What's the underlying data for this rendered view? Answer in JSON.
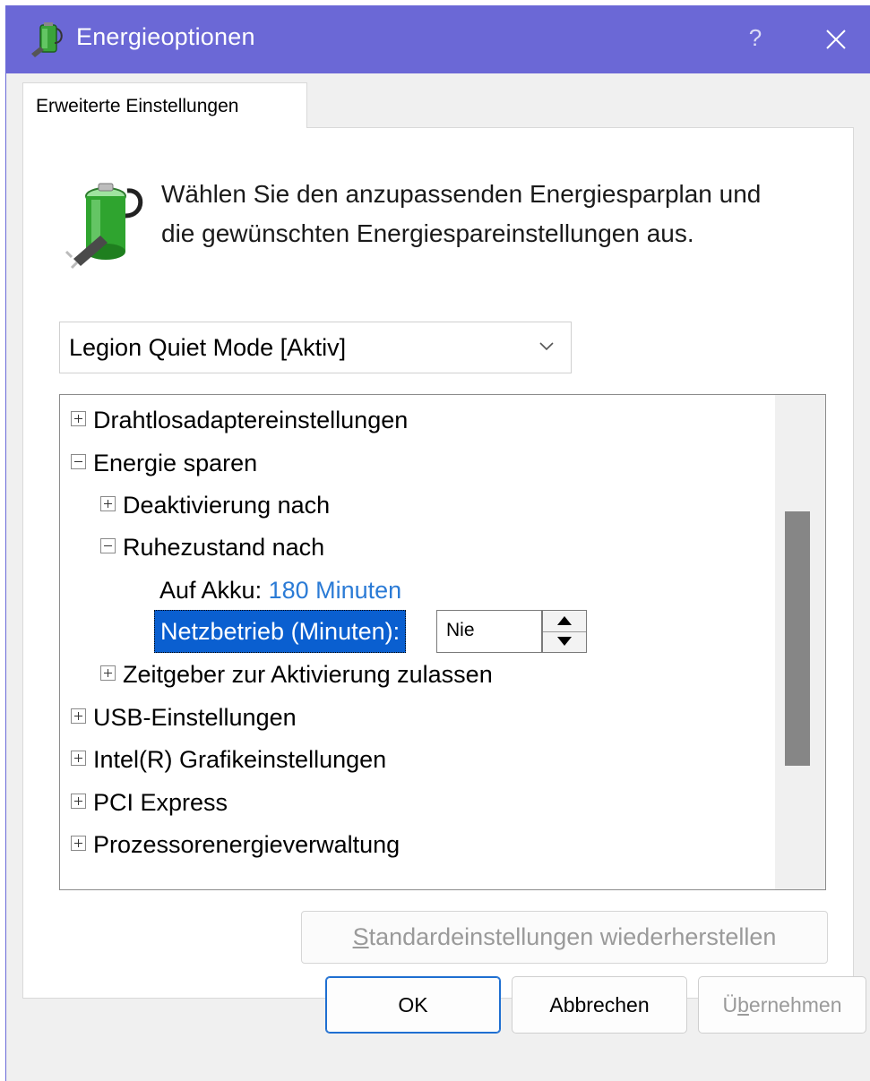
{
  "window": {
    "title": "Energieoptionen",
    "help_label": "?"
  },
  "tab": {
    "label": "Erweiterte Einstellungen"
  },
  "description": {
    "line1": "Wählen Sie den anzupassenden Energiesparplan und",
    "line2": "die gewünschten Energiespareinstellungen aus."
  },
  "plan_select": {
    "value": "Legion Quiet Mode [Aktiv]"
  },
  "tree": {
    "items": [
      {
        "label": "Drahtlosadaptereinstellungen",
        "state": "collapsed"
      },
      {
        "label": "Energie sparen",
        "state": "expanded"
      },
      {
        "label": "Deaktivierung nach",
        "state": "collapsed"
      },
      {
        "label": "Ruhezustand nach",
        "state": "expanded"
      },
      {
        "label": "Zeitgeber zur Aktivierung zulassen",
        "state": "collapsed"
      },
      {
        "label": "USB-Einstellungen",
        "state": "collapsed"
      },
      {
        "label": "Intel(R) Grafikeinstellungen",
        "state": "collapsed"
      },
      {
        "label": "PCI Express",
        "state": "collapsed"
      },
      {
        "label": "Prozessorenergieverwaltung",
        "state": "collapsed"
      }
    ],
    "battery": {
      "label": "Auf Akku:",
      "value": "180 Minuten"
    },
    "plugged": {
      "label": "Netzbetrieb (Minuten):",
      "value": "Nie"
    }
  },
  "buttons": {
    "restore_prefix": "S",
    "restore_rest": "tandardeinstellungen wiederherstellen",
    "ok": "OK",
    "cancel": "Abbrechen",
    "apply_prefix": "Ü",
    "apply_u": "b",
    "apply_rest": "ernehmen"
  },
  "colors": {
    "titlebar": "#6b68d6",
    "selection": "#0a5fd0",
    "link_value": "#2b7bd6"
  }
}
